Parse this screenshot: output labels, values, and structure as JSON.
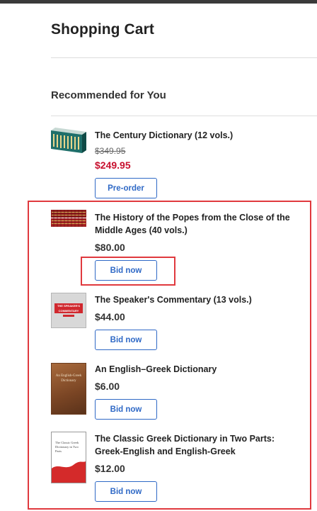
{
  "page": {
    "title": "Shopping Cart",
    "section_title": "Recommended for You"
  },
  "products": [
    {
      "name": "The Century Dictionary (12 vols.)",
      "old_price": "$349.95",
      "price": "$249.95",
      "button": "Pre-order"
    },
    {
      "name": "The History of the Popes from the Close of the Middle Ages (40 vols.)",
      "price": "$80.00",
      "button": "Bid now"
    },
    {
      "name": "The Speaker's Commentary (13 vols.)",
      "price": "$44.00",
      "button": "Bid now",
      "cover_text": "THE SPEAKER'S COMMENTARY"
    },
    {
      "name": "An English–Greek Dictionary",
      "price": "$6.00",
      "button": "Bid now",
      "cover_text": "An English-Greek Dictionary"
    },
    {
      "name": "The Classic Greek Dictionary in Two Parts: Greek-English and English-Greek",
      "price": "$12.00",
      "button": "Bid now",
      "cover_text": "The Classic Greek Dictionary in Two Parts"
    }
  ],
  "colors": {
    "accent": "#2f69c6",
    "sale": "#c8102e",
    "highlight": "#e0393e"
  },
  "icons": {
    "p1": "book-set-teal-image",
    "p2": "book-set-red-image",
    "p3": "book-cover-image",
    "p4": "book-cover-image",
    "p5": "book-cover-image"
  }
}
